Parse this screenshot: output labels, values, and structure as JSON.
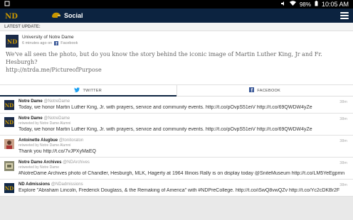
{
  "statusbar": {
    "battery": "98%",
    "time": "10:05 AM"
  },
  "appbar": {
    "title": "Social"
  },
  "latest": {
    "header": "LATEST UPDATE:",
    "name": "University of Notre Dame",
    "time": "6 minutes ago on",
    "source": "Facebook",
    "text1": "We've all seen the photo, but do you know the story behind the iconic image of Martin Luther King, Jr and Fr. Hesburgh?",
    "text2": "http://ntrda.me/PictureofPurpose"
  },
  "tabs": [
    {
      "label": "TWITTER",
      "icon": "twitter-bird-icon"
    },
    {
      "label": "FACEBOOK",
      "icon": "facebook-icon"
    }
  ],
  "tweets": [
    {
      "name": "Notre Dame",
      "handle": "@NotreDame",
      "retweet": "",
      "text": "Today, we honor Martin Luther King, Jr. with prayers, service and community events. http://t.co/pOvpS51eiV http://t.co/69QWDW4yZe",
      "ago": "38m"
    },
    {
      "name": "Notre Dame",
      "handle": "@NotreDame",
      "retweet": "retweeted by Notre Dame Alumni",
      "text": "Today, we honor Martin Luther King, Jr. with prayers, service and community events. http://t.co/pOvpS51eiV http://t.co/69QWDW4yZe",
      "ago": "38m"
    },
    {
      "name": "Antoinette Alugbue",
      "handle": "@tonitoraton",
      "retweet": "retweeted by Notre Dame Alumni",
      "text": "Thank you http://t.co/7vJPXyMaEQ",
      "ago": "38m"
    },
    {
      "name": "Notre Dame Archives",
      "handle": "@NDArchives",
      "retweet": "retweeted by Notre Dame",
      "text": "#NotreDame Archives photo of Chandler, Hesburgh, MLK, Hagerty at 1964 Illinois Rally is on display today @SniteMuseum http://t.co/LM5YeEgpmn",
      "ago": "38m"
    },
    {
      "name": "ND Admissions",
      "handle": "@NDadmissions",
      "retweet": "",
      "text": "Explore \"Abraham Lincoln, Frederick Douglass, & the Remaking of America\" with #NDPreCollege. http://t.co/iSwQ8vwQZv http://t.co/Yc2cDKBr2F",
      "ago": "38m"
    }
  ]
}
